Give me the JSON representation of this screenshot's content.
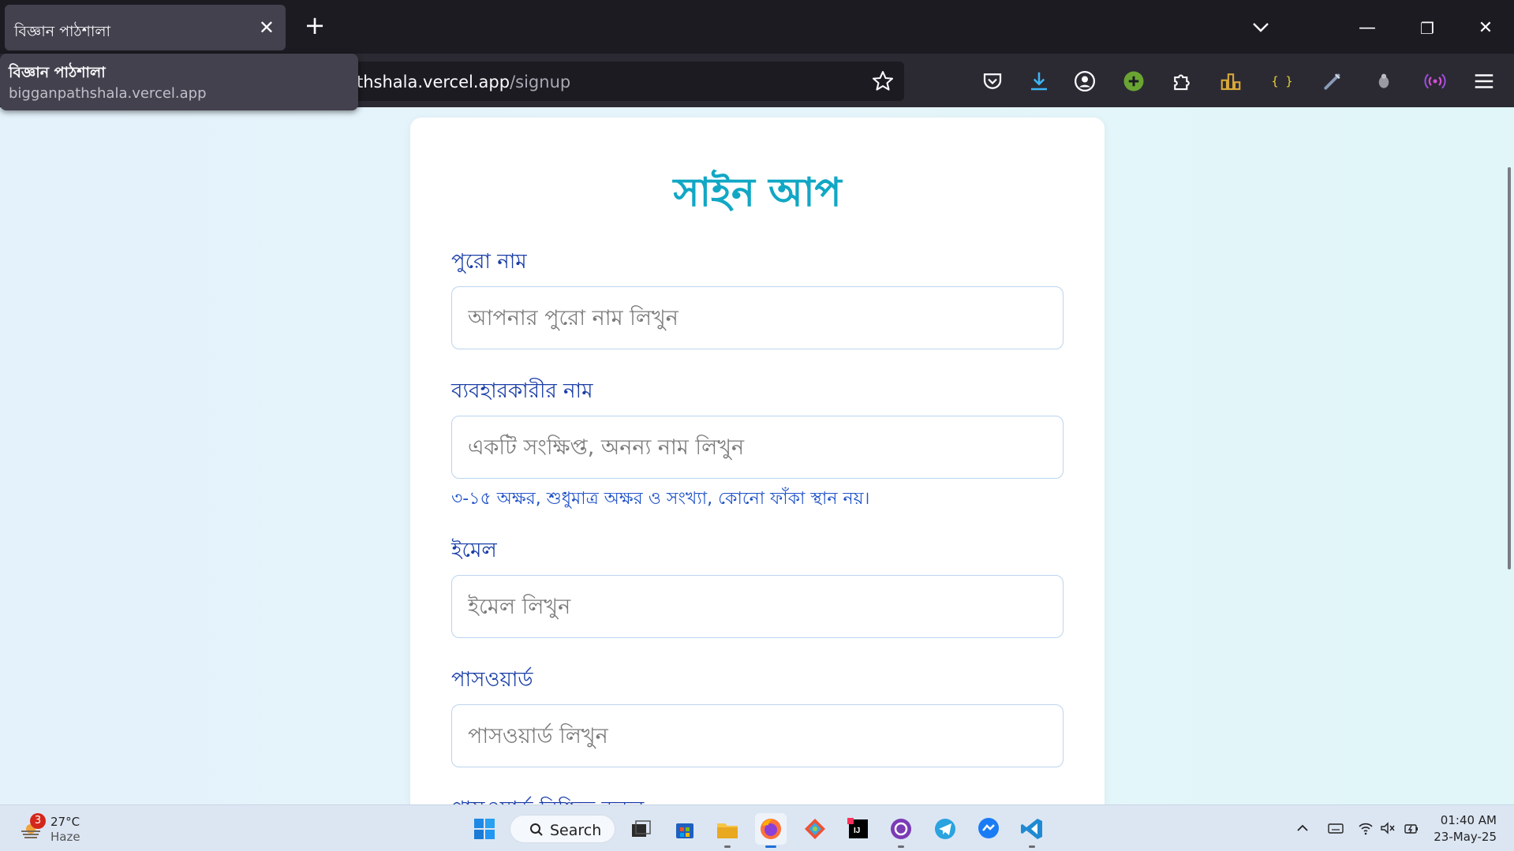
{
  "browser": {
    "tab": {
      "title": "বিজ্ঞান পাঠশালা",
      "close_glyph": "✕"
    },
    "new_tab_glyph": "+",
    "window": {
      "minimize_glyph": "—",
      "restore_glyph": "❐",
      "close_glyph": "✕"
    },
    "tooltip": {
      "title": "বিজ্ঞান পাঠশালা",
      "url": "bigganpathshala.vercel.app"
    },
    "address": {
      "host": "thshala.vercel.app",
      "path": "/signup"
    },
    "toolbar_icons": [
      "pocket-icon",
      "downloads-icon",
      "account-icon",
      "extension-green-icon",
      "extensions-icon",
      "extension-chart-icon",
      "extension-json-icon",
      "extension-pen-icon",
      "extension-bug-icon",
      "extension-broadcast-icon",
      "menu-icon"
    ]
  },
  "form": {
    "title": "সাইন আপ",
    "fields": [
      {
        "label": "পুরো নাম",
        "placeholder": "আপনার পুরো নাম লিখুন"
      },
      {
        "label": "ব্যবহারকারীর নাম",
        "placeholder": "একটি সংক্ষিপ্ত, অনন্য নাম লিখুন",
        "hint": "৩-১৫ অক্ষর, শুধুমাত্র অক্ষর ও সংখ্যা, কোনো ফাঁকা স্থান নয়।"
      },
      {
        "label": "ইমেল",
        "placeholder": "ইমেল লিখুন"
      },
      {
        "label": "পাসওয়ার্ড",
        "placeholder": "পাসওয়ার্ড লিখুন"
      },
      {
        "label": "পাসওয়ার্ড নিশ্চিত করুন"
      }
    ]
  },
  "taskbar": {
    "weather": {
      "badge": "3",
      "temp": "27°C",
      "desc": "Haze"
    },
    "search_label": "Search",
    "apps": [
      "start-icon",
      "task-view-icon",
      "store-icon",
      "file-explorer-icon",
      "firefox-icon",
      "git-icon",
      "intellij-icon",
      "github-desktop-icon",
      "telegram-icon",
      "messenger-icon",
      "vscode-icon"
    ],
    "clock": {
      "time": "01:40 AM",
      "date": "23-May-25"
    }
  },
  "colors": {
    "accent_title": "#11a7c5",
    "label": "#1a3ea8",
    "hint": "#1f52c9",
    "download_blue": "#3fb5f5"
  }
}
